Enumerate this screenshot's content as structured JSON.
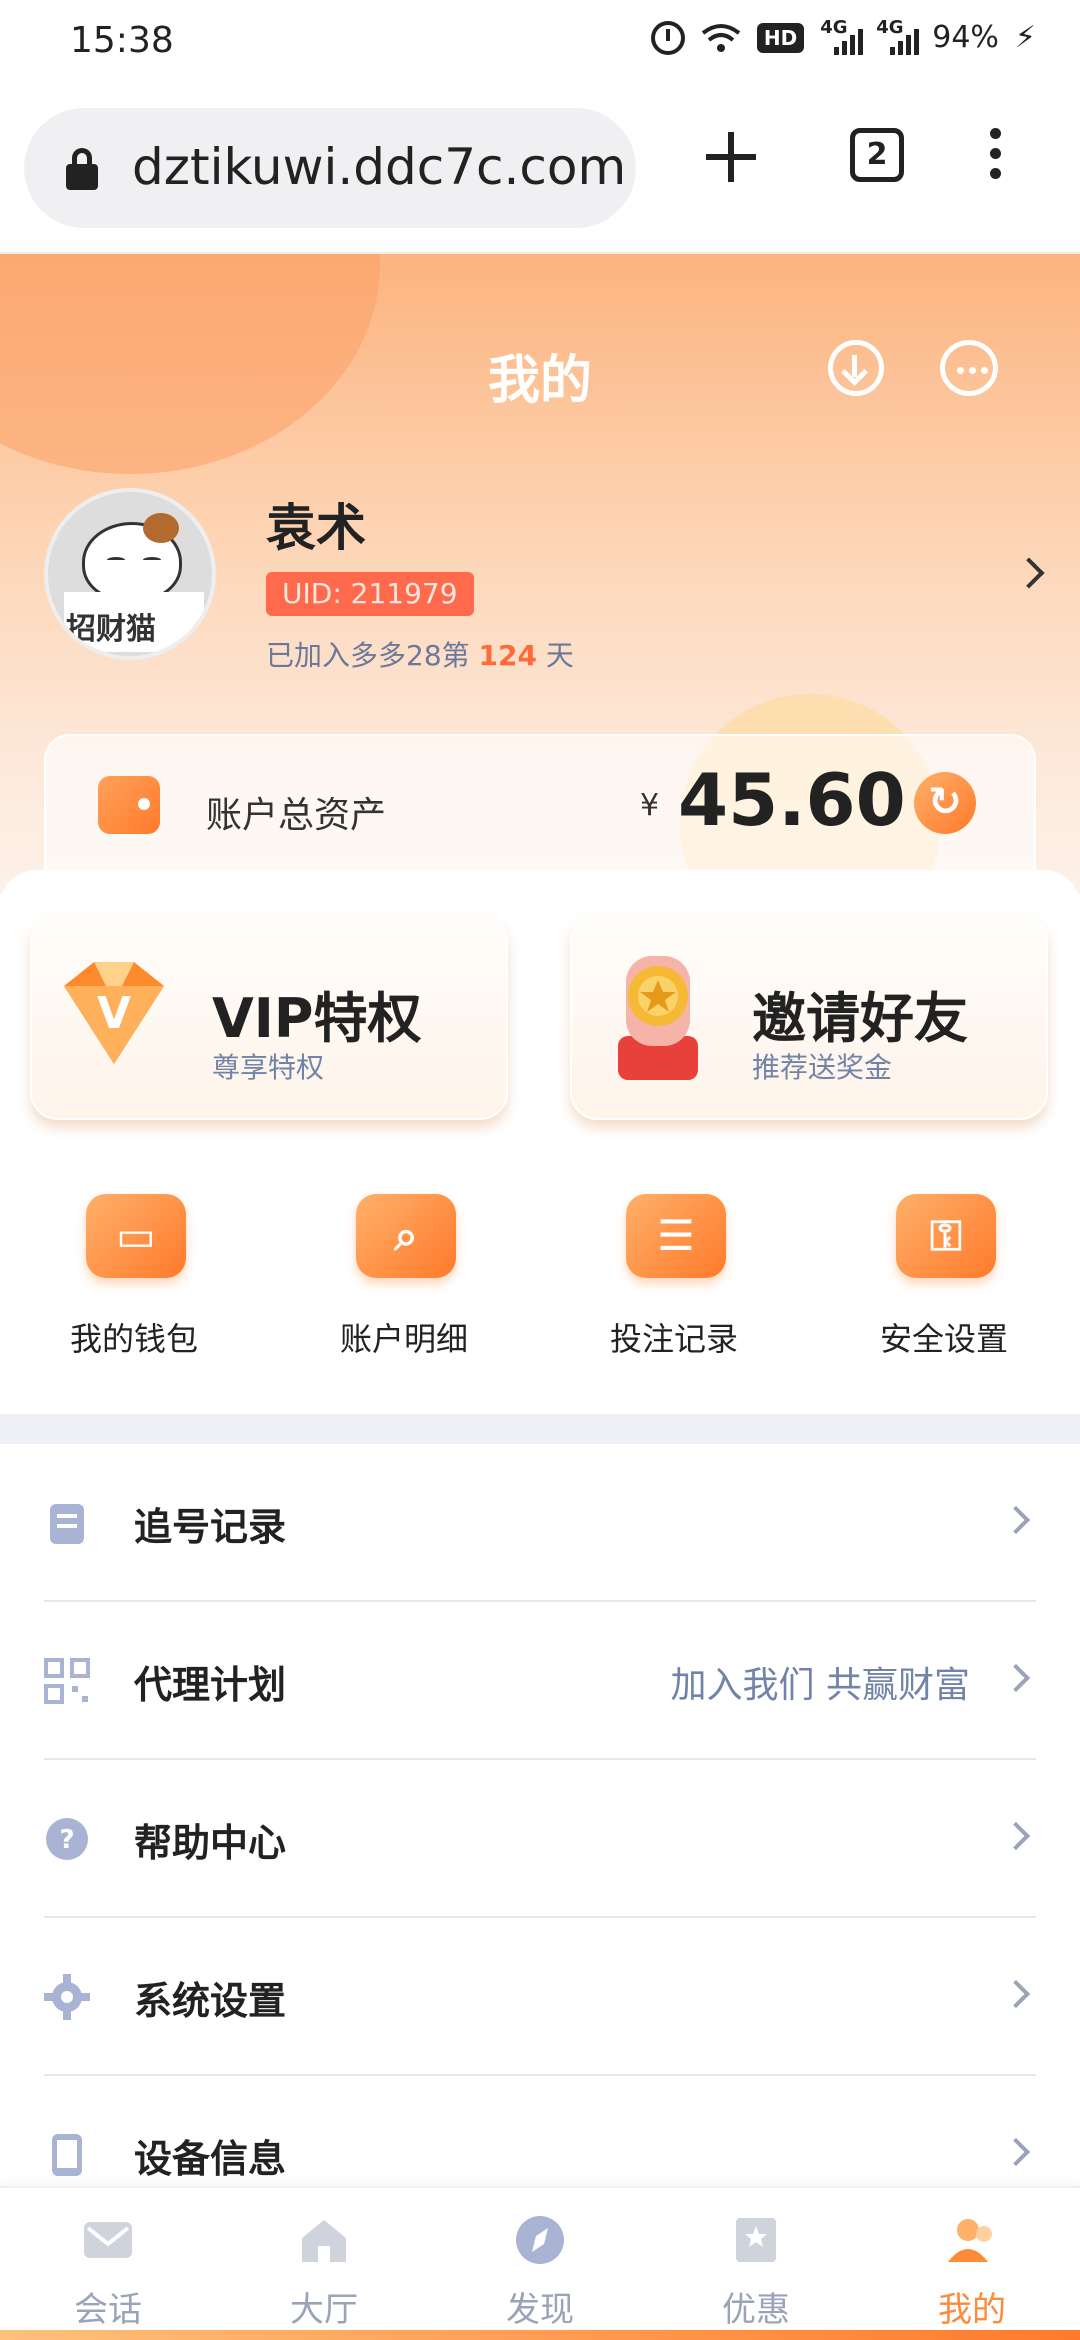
{
  "status": {
    "time": "15:38",
    "network_a": "4G",
    "network_b": "4G",
    "hd": "HD",
    "battery": "94%"
  },
  "browser": {
    "url": "dztikuwi.ddc7c.com",
    "tab_count": "2"
  },
  "header": {
    "title": "我的"
  },
  "profile": {
    "name": "袁术",
    "uid": "UID: 211979",
    "joined_prefix": "已加入多多28第 ",
    "joined_days": "124",
    "joined_suffix": " 天",
    "avatar_text": "招财猫"
  },
  "assets": {
    "label": "账户总资产",
    "currency": "¥",
    "amount": "45.60"
  },
  "features": [
    {
      "title": "VIP特权",
      "subtitle": "尊享特权"
    },
    {
      "title": "邀请好友",
      "subtitle": "推荐送奖金"
    }
  ],
  "quick_actions": [
    {
      "label": "我的钱包",
      "icon": "wallet-icon"
    },
    {
      "label": "账户明细",
      "icon": "search-icon"
    },
    {
      "label": "投注记录",
      "icon": "notepad-icon"
    },
    {
      "label": "安全设置",
      "icon": "key-icon"
    }
  ],
  "menu": [
    {
      "label": "追号记录",
      "right": "",
      "icon": "clipboard-icon"
    },
    {
      "label": "代理计划",
      "right": "加入我们 共赢财富",
      "icon": "qr-icon"
    },
    {
      "label": "帮助中心",
      "right": "",
      "icon": "help-icon"
    },
    {
      "label": "系统设置",
      "right": "",
      "icon": "gear-icon"
    },
    {
      "label": "设备信息",
      "right": "",
      "icon": "phone-icon"
    }
  ],
  "nav": [
    {
      "label": "会话",
      "icon": "mail-icon",
      "active": false
    },
    {
      "label": "大厅",
      "icon": "home-icon",
      "active": false
    },
    {
      "label": "发现",
      "icon": "compass-icon",
      "active": false
    },
    {
      "label": "优惠",
      "icon": "coupon-icon",
      "active": false
    },
    {
      "label": "我的",
      "icon": "user-icon",
      "active": true
    }
  ],
  "colors": {
    "accent": "#ff7a2b",
    "uid_badge": "#ff6a4d",
    "muted": "#7283a8"
  }
}
